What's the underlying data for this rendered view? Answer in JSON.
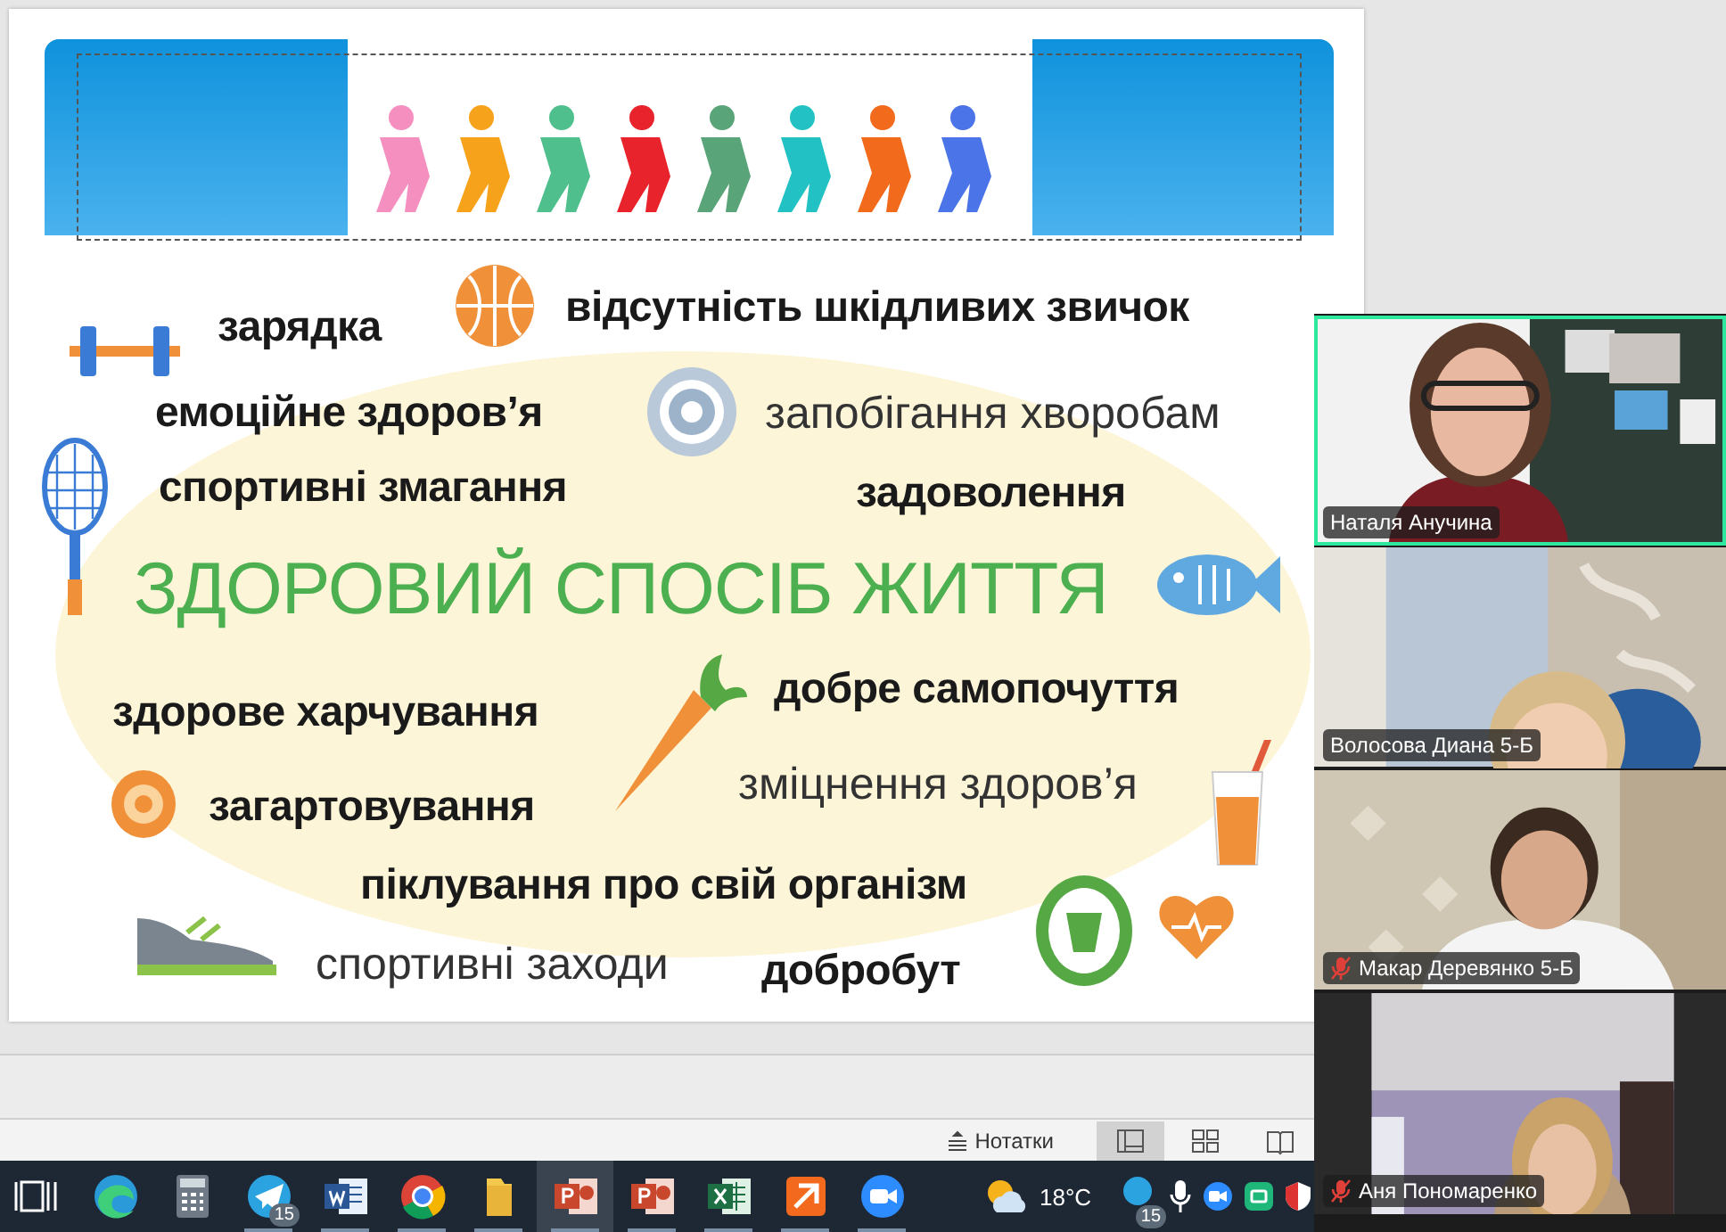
{
  "slide": {
    "words": [
      {
        "text": "зарядка",
        "kind": "bold"
      },
      {
        "text": "відсутність шкідливих звичок",
        "kind": "bold"
      },
      {
        "text": "емоційне здоров’я",
        "kind": "bold"
      },
      {
        "text": "запобігання хворобам",
        "kind": "regular"
      },
      {
        "text": "спортивні змагання",
        "kind": "bold"
      },
      {
        "text": "задоволення",
        "kind": "bold"
      },
      {
        "text": "ЗДОРОВИЙ СПОСІБ ЖИТТЯ",
        "kind": "title"
      },
      {
        "text": "здорове харчування",
        "kind": "bold"
      },
      {
        "text": "добре самопочуття",
        "kind": "bold"
      },
      {
        "text": "зміцнення здоров’я",
        "kind": "regular"
      },
      {
        "text": "загартовування",
        "kind": "bold"
      },
      {
        "text": "піклування про свій організм",
        "kind": "bold"
      },
      {
        "text": "спортивні заходи",
        "kind": "regular"
      },
      {
        "text": "добробут",
        "kind": "bold"
      }
    ]
  },
  "status_bar": {
    "notes": "Нотатки",
    "views": [
      {
        "kind": "normal",
        "selected": true
      },
      {
        "kind": "sorter",
        "selected": false
      },
      {
        "kind": "reading",
        "selected": false
      }
    ]
  },
  "taskbar": {
    "apps": [
      {
        "kind": "taskview",
        "running": false,
        "selected": false
      },
      {
        "kind": "edge",
        "running": false,
        "selected": false
      },
      {
        "kind": "calculator",
        "running": false,
        "selected": false
      },
      {
        "kind": "telegram",
        "badge": "15",
        "running": true,
        "selected": false
      },
      {
        "kind": "word",
        "running": true,
        "selected": false
      },
      {
        "kind": "chrome",
        "running": true,
        "selected": false
      },
      {
        "kind": "folder",
        "running": true,
        "selected": false
      },
      {
        "kind": "powerpoint",
        "running": true,
        "selected": true
      },
      {
        "kind": "powerpoint",
        "running": true,
        "selected": false
      },
      {
        "kind": "excel",
        "running": true,
        "selected": false
      },
      {
        "kind": "orange-app",
        "running": true,
        "selected": false
      },
      {
        "kind": "zoom",
        "running": true,
        "selected": false
      }
    ],
    "weather": "18°C",
    "tray": [
      {
        "kind": "badge",
        "badge": "15"
      },
      {
        "kind": "mic"
      },
      {
        "kind": "zoom"
      },
      {
        "kind": "green-app"
      },
      {
        "kind": "shield"
      }
    ]
  },
  "video_panel": {
    "participants": [
      {
        "name": "Наталя Анучина",
        "muted": false,
        "speaking": true
      },
      {
        "name": "Волосова Диана 5-Б",
        "muted": false,
        "speaking": false
      },
      {
        "name": "Макар Деревянко 5-Б",
        "muted": true,
        "speaking": false
      },
      {
        "name": "Аня Пономаренко",
        "muted": true,
        "speaking": false
      }
    ]
  }
}
